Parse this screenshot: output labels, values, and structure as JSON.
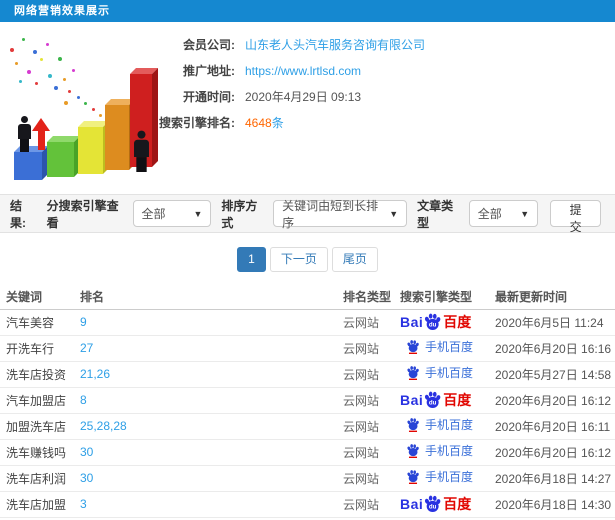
{
  "header": {
    "title": "网络营销效果展示"
  },
  "info": {
    "fields": [
      {
        "label": "会员公司:",
        "value": "山东老人头汽车服务咨询有限公司"
      },
      {
        "label": "推广地址:",
        "value": "https://www.lrtlsd.com"
      },
      {
        "label": "开通时间:",
        "value": "2020年4月29日 09:13"
      },
      {
        "label": "搜索引擎排名:",
        "value": "4648",
        "suffix": "条"
      }
    ]
  },
  "filters": {
    "section_label": "结果:",
    "engine_label": "分搜索引擎查看",
    "engine_value": "全部",
    "sort_label": "排序方式",
    "sort_value": "关键词由短到长排序",
    "type_label": "文章类型",
    "type_value": "全部",
    "submit_label": "提交",
    "caret": "▼"
  },
  "pagination": {
    "current": "1",
    "next": "下一页",
    "last": "尾页"
  },
  "logos": {
    "baidu_prefix": "Bai",
    "baidu_text": "百度",
    "baidu_paw_label": "du",
    "mobile_text": "手机百度"
  },
  "table": {
    "columns": [
      "关键词",
      "排名",
      "排名类型",
      "搜索引擎类型",
      "最新更新时间"
    ],
    "rows": [
      {
        "keyword": "汽车美容",
        "rank": "9",
        "rank_type": "云网站",
        "engine": "baidu",
        "time": "2020年6月5日 11:24"
      },
      {
        "keyword": "开洗车行",
        "rank": "27",
        "rank_type": "云网站",
        "engine": "mobile",
        "time": "2020年6月20日 16:16"
      },
      {
        "keyword": "洗车店投资",
        "rank": "21,26",
        "rank_type": "云网站",
        "engine": "mobile",
        "time": "2020年5月27日 14:58"
      },
      {
        "keyword": "汽车加盟店",
        "rank": "8",
        "rank_type": "云网站",
        "engine": "baidu",
        "time": "2020年6月20日 16:12"
      },
      {
        "keyword": "加盟洗车店",
        "rank": "25,28,28",
        "rank_type": "云网站",
        "engine": "mobile",
        "time": "2020年6月20日 16:11"
      },
      {
        "keyword": "洗车赚钱吗",
        "rank": "30",
        "rank_type": "云网站",
        "engine": "mobile",
        "time": "2020年6月20日 16:12"
      },
      {
        "keyword": "洗车店利润",
        "rank": "30",
        "rank_type": "云网站",
        "engine": "mobile",
        "time": "2020年6月18日 14:27"
      },
      {
        "keyword": "洗车店加盟",
        "rank": "3",
        "rank_type": "云网站",
        "engine": "baidu",
        "time": "2020年6月18日 14:30"
      }
    ]
  },
  "colors": {
    "header_blue": "#1588d0",
    "link_blue": "#2e9fe6",
    "highlight_orange": "#ff6600",
    "baidu_blue": "#2932e1",
    "baidu_red": "#e10601",
    "pagination_active": "#337ab7"
  }
}
